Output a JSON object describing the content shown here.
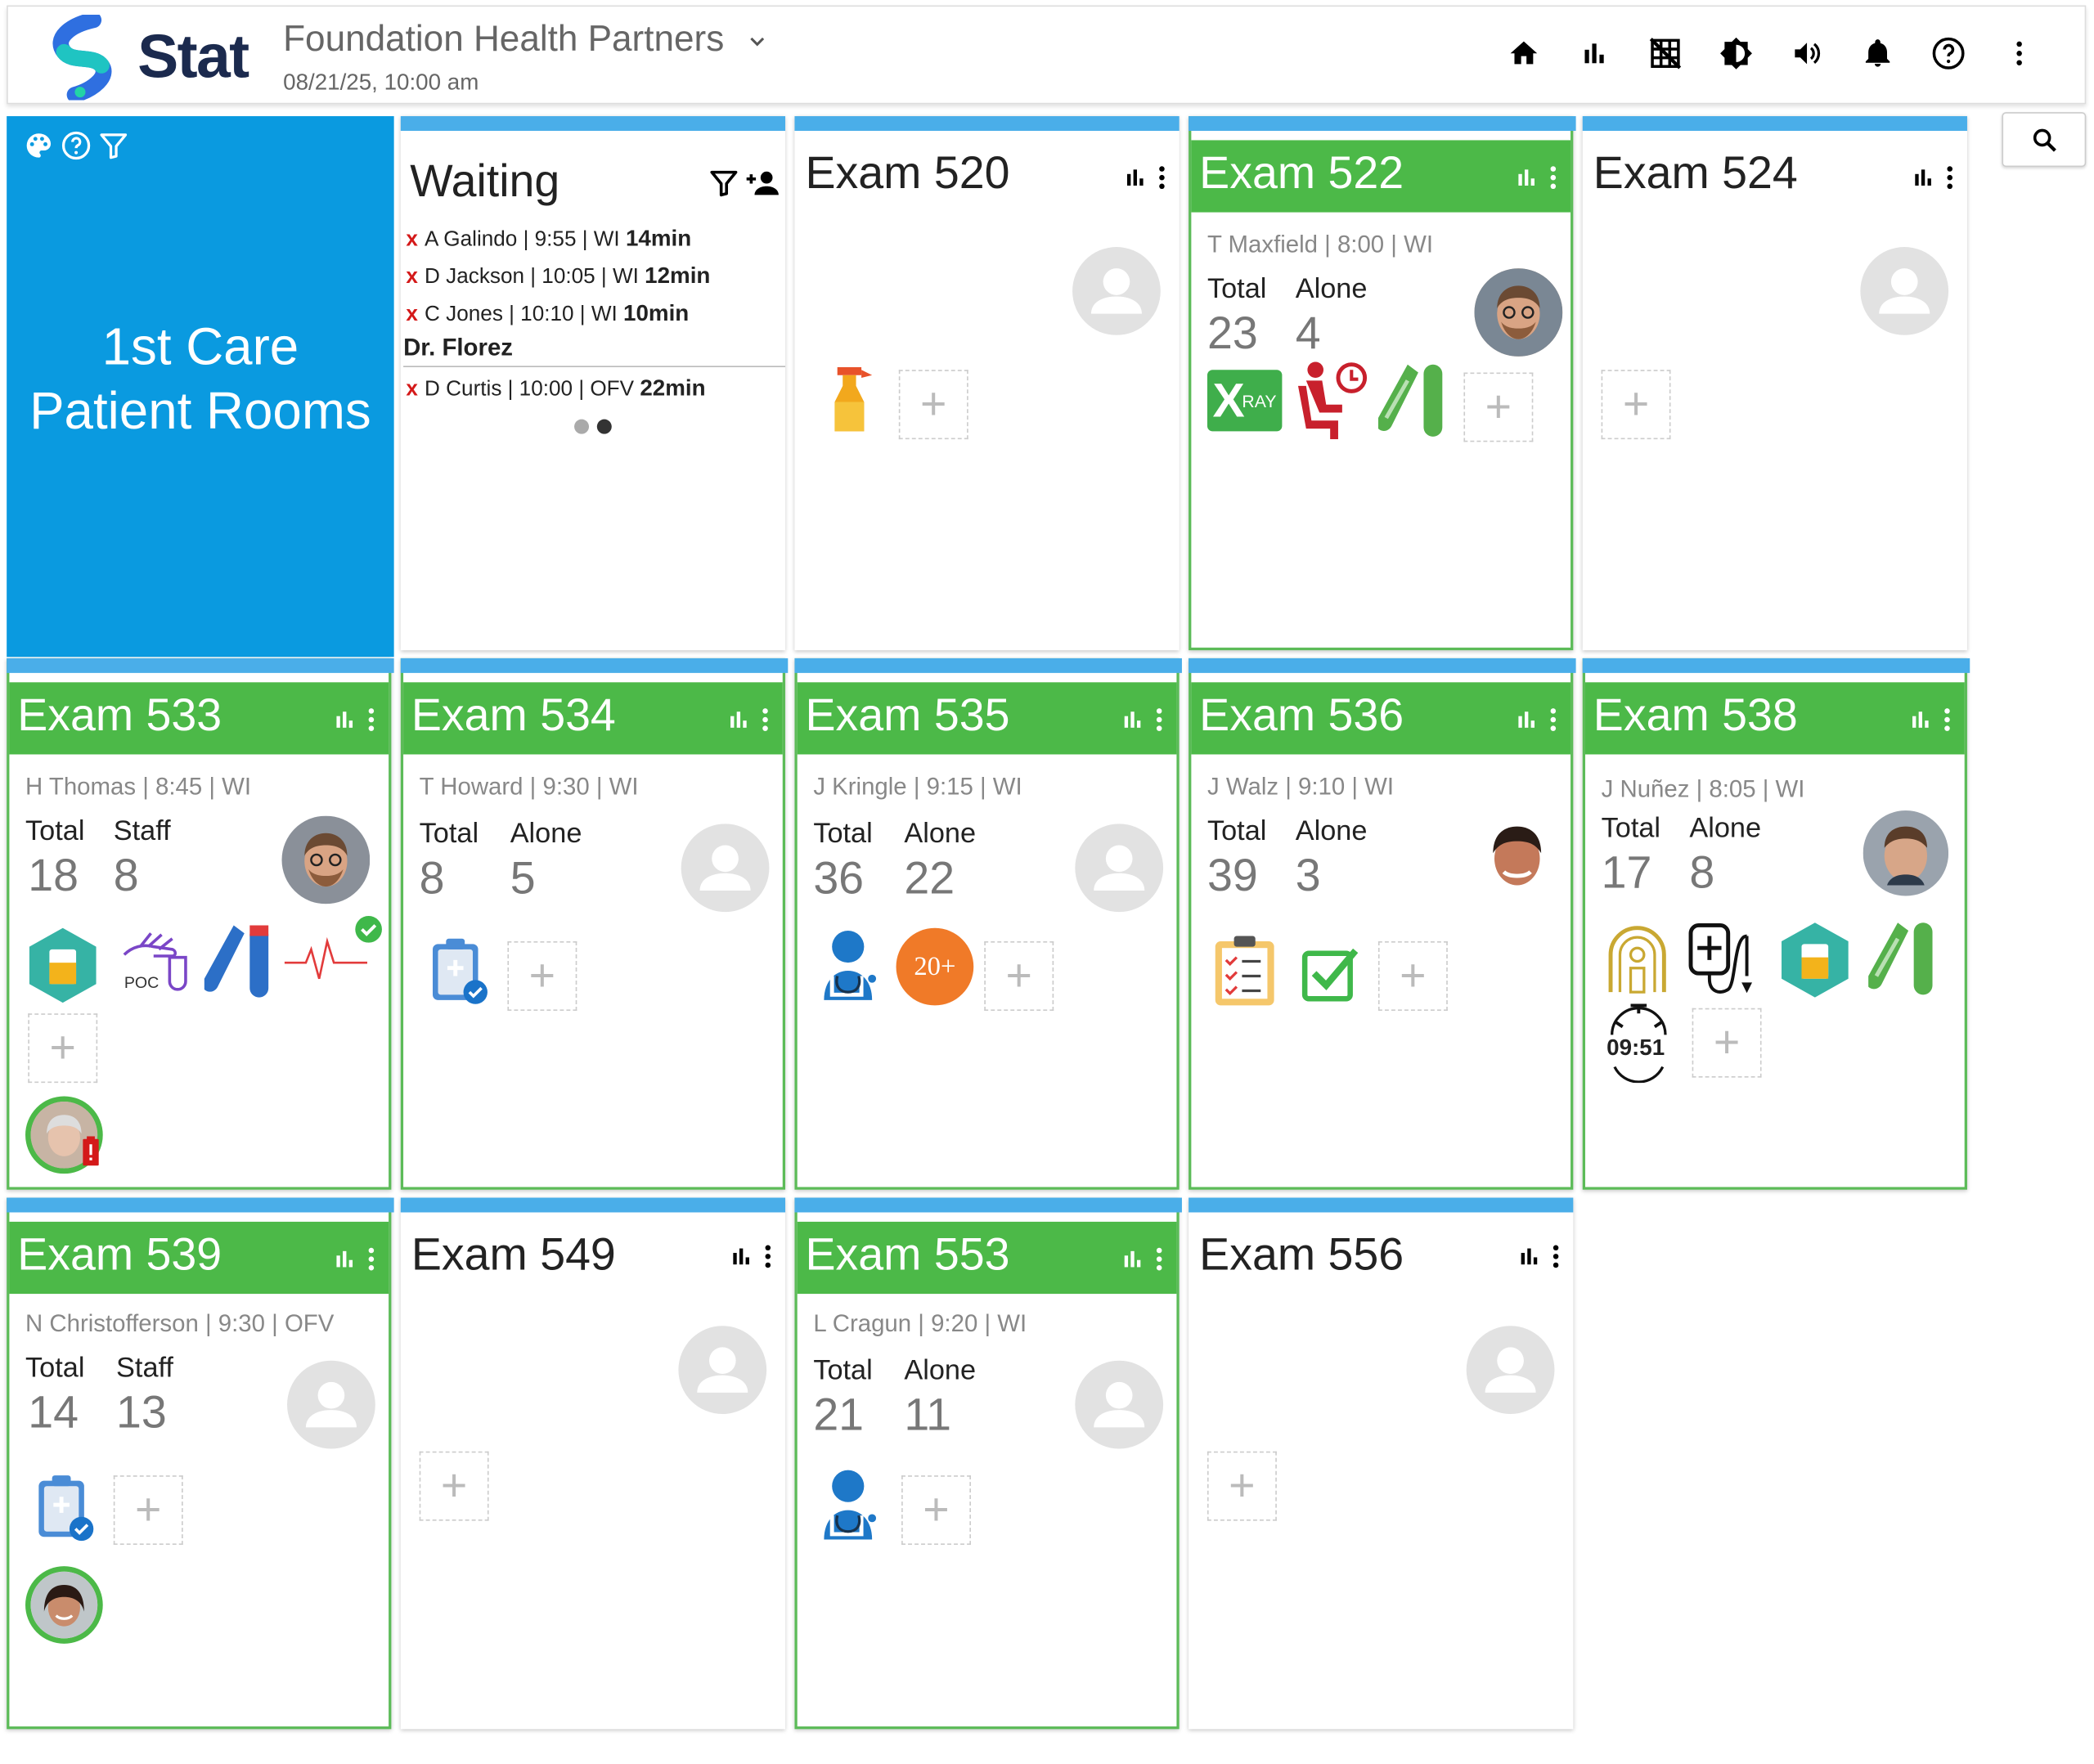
{
  "header": {
    "brand": "Stat",
    "org_name": "Foundation Health Partners",
    "date_time": "08/21/25, 10:00 am",
    "icons": [
      "home-icon",
      "bar-chart-icon",
      "grid-off-icon",
      "brightness-icon",
      "volume-icon",
      "bell-icon",
      "help-icon",
      "more-vert-icon"
    ]
  },
  "title_panel": {
    "line1": "1st Care",
    "line2": "Patient Rooms"
  },
  "colors": {
    "header_blue": "#0a9ae0",
    "occupied_green": "#4cb948",
    "strip_blue": "#4aaee9",
    "alert_red": "#d41919"
  },
  "waiting": {
    "title": "Waiting",
    "rows": [
      {
        "mark": "x",
        "text": "A Galindo | 9:55 | WI",
        "time": "14min"
      },
      {
        "mark": "x",
        "text": "D Jackson | 10:05 | WI",
        "time": "12min"
      },
      {
        "mark": "x",
        "text": "C Jones | 10:10 | WI",
        "time": "10min"
      }
    ],
    "group": "Dr. Florez",
    "group_rows": [
      {
        "mark": "x",
        "text": "D Curtis | 10:00 | OFV",
        "time": "22min"
      }
    ]
  },
  "plus": "+",
  "rooms": {
    "r520": {
      "title": "Exam 520"
    },
    "r522": {
      "title": "Exam 522",
      "patient": "T Maxfield | 8:00 | WI",
      "l1": "Total",
      "l2": "Alone",
      "v1": "23",
      "v2": "4",
      "xray": "RAY"
    },
    "r524": {
      "title": "Exam 524"
    },
    "r533": {
      "title": "Exam 533",
      "patient": "H Thomas | 8:45 | WI",
      "l1": "Total",
      "l2": "Staff",
      "v1": "18",
      "v2": "8",
      "poc": "POC"
    },
    "r534": {
      "title": "Exam 534",
      "patient": "T Howard | 9:30 | WI",
      "l1": "Total",
      "l2": "Alone",
      "v1": "8",
      "v2": "5"
    },
    "r535": {
      "title": "Exam 535",
      "patient": "J Kringle | 9:15 | WI",
      "l1": "Total",
      "l2": "Alone",
      "v1": "36",
      "v2": "22",
      "badge": "20+"
    },
    "r536": {
      "title": "Exam 536",
      "patient": "J Walz | 9:10 | WI",
      "l1": "Total",
      "l2": "Alone",
      "v1": "39",
      "v2": "3"
    },
    "r538": {
      "title": "Exam 538",
      "patient": "J Nuñez | 8:05 | WI",
      "l1": "Total",
      "l2": "Alone",
      "v1": "17",
      "v2": "8",
      "timer": "09:51"
    },
    "r539": {
      "title": "Exam 539",
      "patient": "N Christofferson | 9:30 | OFV",
      "l1": "Total",
      "l2": "Staff",
      "v1": "14",
      "v2": "13"
    },
    "r549": {
      "title": "Exam 549"
    },
    "r553": {
      "title": "Exam 553",
      "patient": "L Cragun | 9:20 | WI",
      "l1": "Total",
      "l2": "Alone",
      "v1": "21",
      "v2": "11"
    },
    "r556": {
      "title": "Exam 556"
    }
  }
}
